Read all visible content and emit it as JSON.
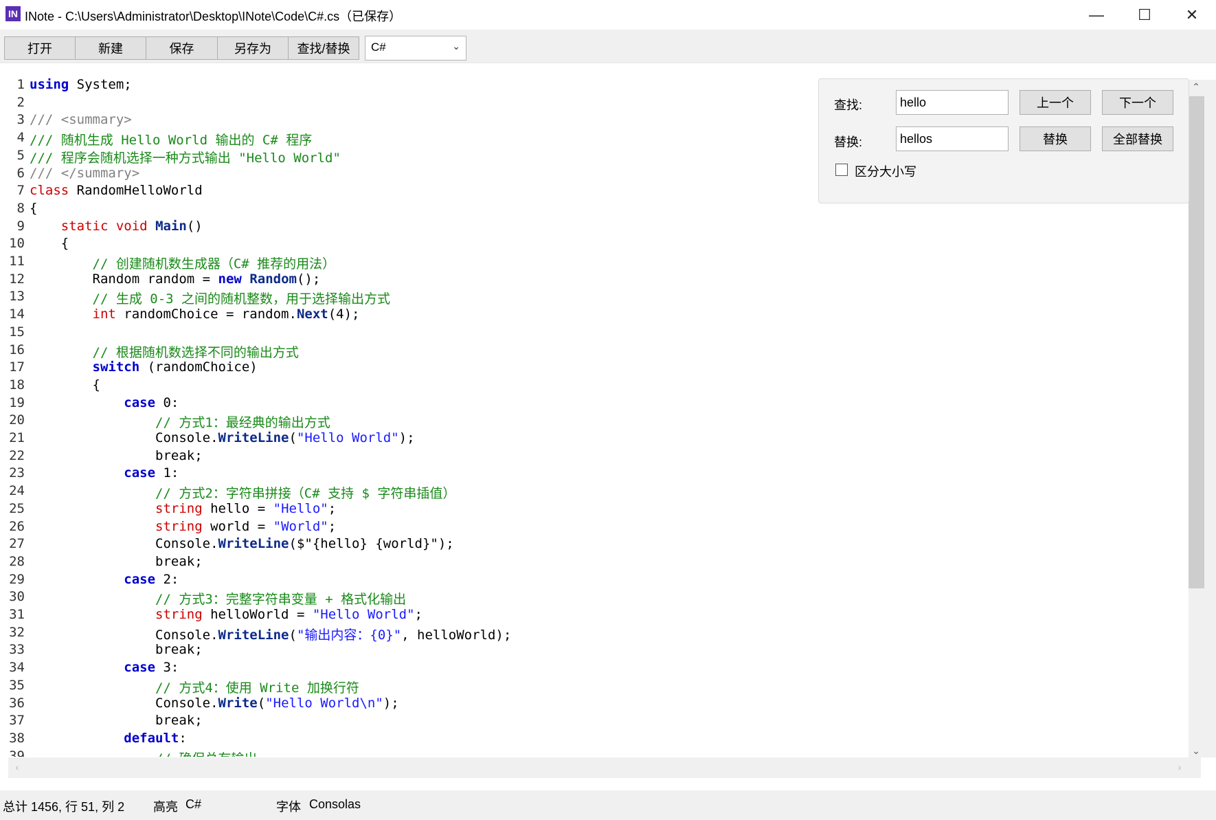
{
  "window": {
    "app_icon_text": "IN",
    "title": "INote - C:\\Users\\Administrator\\Desktop\\INote\\Code\\C#.cs（已保存）",
    "controls": {
      "minimize": "—",
      "maximize": "☐",
      "close": "✕"
    }
  },
  "toolbar": {
    "open": "打开",
    "new": "新建",
    "save": "保存",
    "save_as": "另存为",
    "find_replace": "查找/替换",
    "language": "C#"
  },
  "find_panel": {
    "find_label": "查找:",
    "find_value": "hello",
    "replace_label": "替换:",
    "replace_value": "hellos",
    "prev_button": "上一个",
    "next_button": "下一个",
    "replace_button": "替换",
    "replace_all_button": "全部替换",
    "case_sensitive_label": "区分大小写",
    "case_sensitive_checked": false
  },
  "editor": {
    "lines": [
      [
        {
          "t": "using",
          "c": "kw"
        },
        {
          "t": " System;"
        }
      ],
      [],
      [
        {
          "t": "/// <summary>",
          "c": "xdoc"
        }
      ],
      [
        {
          "t": "/// 随机生成 Hello World 输出的 C# 程序",
          "c": "cm"
        }
      ],
      [
        {
          "t": "/// 程序会随机选择一种方式输出 \"Hello World\"",
          "c": "cm"
        }
      ],
      [
        {
          "t": "/// </summary>",
          "c": "xdoc"
        }
      ],
      [
        {
          "t": "class",
          "c": "kw2"
        },
        {
          "t": " RandomHelloWorld"
        }
      ],
      [
        {
          "t": "{"
        }
      ],
      [
        {
          "t": "    "
        },
        {
          "t": "static",
          "c": "kw2"
        },
        {
          "t": " "
        },
        {
          "t": "void",
          "c": "kw2"
        },
        {
          "t": " "
        },
        {
          "t": "Main",
          "c": "mth"
        },
        {
          "t": "()"
        }
      ],
      [
        {
          "t": "    {"
        }
      ],
      [
        {
          "t": "        "
        },
        {
          "t": "// 创建随机数生成器（C# 推荐的用法）",
          "c": "cm"
        }
      ],
      [
        {
          "t": "        Random random = "
        },
        {
          "t": "new",
          "c": "kw"
        },
        {
          "t": " "
        },
        {
          "t": "Random",
          "c": "mth"
        },
        {
          "t": "();"
        }
      ],
      [
        {
          "t": "        "
        },
        {
          "t": "// 生成 0-3 之间的随机整数，用于选择输出方式",
          "c": "cm"
        }
      ],
      [
        {
          "t": "        "
        },
        {
          "t": "int",
          "c": "kw2"
        },
        {
          "t": " randomChoice = random."
        },
        {
          "t": "Next",
          "c": "mth"
        },
        {
          "t": "(4);"
        }
      ],
      [],
      [
        {
          "t": "        "
        },
        {
          "t": "// 根据随机数选择不同的输出方式",
          "c": "cm"
        }
      ],
      [
        {
          "t": "        "
        },
        {
          "t": "switch",
          "c": "kw"
        },
        {
          "t": " (randomChoice)"
        }
      ],
      [
        {
          "t": "        {"
        }
      ],
      [
        {
          "t": "            "
        },
        {
          "t": "case",
          "c": "kw"
        },
        {
          "t": " 0:"
        }
      ],
      [
        {
          "t": "                "
        },
        {
          "t": "// 方式1：最经典的输出方式",
          "c": "cm"
        }
      ],
      [
        {
          "t": "                Console."
        },
        {
          "t": "WriteLine",
          "c": "mth"
        },
        {
          "t": "("
        },
        {
          "t": "\"Hello World\"",
          "c": "str"
        },
        {
          "t": ");"
        }
      ],
      [
        {
          "t": "                break;"
        }
      ],
      [
        {
          "t": "            "
        },
        {
          "t": "case",
          "c": "kw"
        },
        {
          "t": " 1:"
        }
      ],
      [
        {
          "t": "                "
        },
        {
          "t": "// 方式2：字符串拼接（C# 支持 $ 字符串插值）",
          "c": "cm"
        }
      ],
      [
        {
          "t": "                "
        },
        {
          "t": "string",
          "c": "kw2"
        },
        {
          "t": " hello = "
        },
        {
          "t": "\"Hello\"",
          "c": "str"
        },
        {
          "t": ";"
        }
      ],
      [
        {
          "t": "                "
        },
        {
          "t": "string",
          "c": "kw2"
        },
        {
          "t": " world = "
        },
        {
          "t": "\"World\"",
          "c": "str"
        },
        {
          "t": ";"
        }
      ],
      [
        {
          "t": "                Console."
        },
        {
          "t": "WriteLine",
          "c": "mth"
        },
        {
          "t": "($\"{hello} {world}\");"
        }
      ],
      [
        {
          "t": "                break;"
        }
      ],
      [
        {
          "t": "            "
        },
        {
          "t": "case",
          "c": "kw"
        },
        {
          "t": " 2:"
        }
      ],
      [
        {
          "t": "                "
        },
        {
          "t": "// 方式3：完整字符串变量 + 格式化输出",
          "c": "cm"
        }
      ],
      [
        {
          "t": "                "
        },
        {
          "t": "string",
          "c": "kw2"
        },
        {
          "t": " helloWorld = "
        },
        {
          "t": "\"Hello World\"",
          "c": "str"
        },
        {
          "t": ";"
        }
      ],
      [
        {
          "t": "                Console."
        },
        {
          "t": "WriteLine",
          "c": "mth"
        },
        {
          "t": "("
        },
        {
          "t": "\"输出内容：{0}\"",
          "c": "str"
        },
        {
          "t": ", helloWorld);"
        }
      ],
      [
        {
          "t": "                break;"
        }
      ],
      [
        {
          "t": "            "
        },
        {
          "t": "case",
          "c": "kw"
        },
        {
          "t": " 3:"
        }
      ],
      [
        {
          "t": "                "
        },
        {
          "t": "// 方式4：使用 Write 加换行符",
          "c": "cm"
        }
      ],
      [
        {
          "t": "                Console."
        },
        {
          "t": "Write",
          "c": "mth"
        },
        {
          "t": "("
        },
        {
          "t": "\"Hello World\\n\"",
          "c": "str"
        },
        {
          "t": ");"
        }
      ],
      [
        {
          "t": "                break;"
        }
      ],
      [
        {
          "t": "            "
        },
        {
          "t": "default",
          "c": "kw"
        },
        {
          "t": ":"
        }
      ],
      [
        {
          "t": "                "
        },
        {
          "t": "// 确保总有输出",
          "c": "cm"
        }
      ]
    ]
  },
  "scrollbar": {
    "up": "⌃",
    "down": "⌄",
    "left": "‹",
    "right": "›"
  },
  "status": {
    "position": "总计 1456, 行 51, 列 2",
    "highlight_label": "高亮",
    "highlight_value": "C#",
    "font_label": "字体",
    "font_value": "Consolas"
  }
}
